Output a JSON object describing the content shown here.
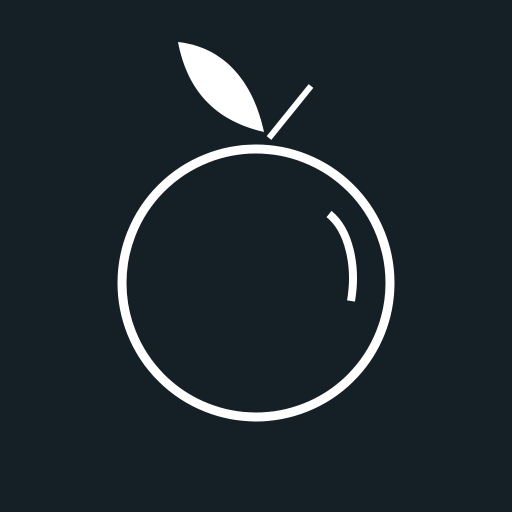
{
  "icon": {
    "name": "fruit-icon",
    "description_visible_text": "",
    "background_color": "#151f26",
    "stroke_color": "#ffffff",
    "leaf_color": "#ffffff"
  }
}
